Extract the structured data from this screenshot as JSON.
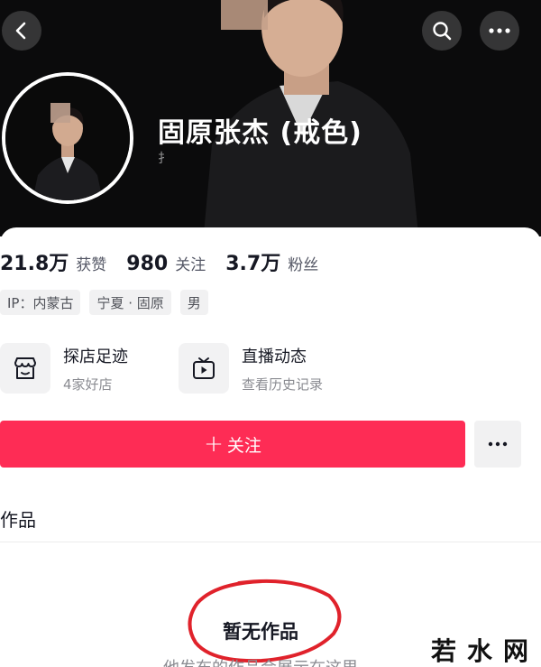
{
  "profile": {
    "nickname": "固原张杰 (戒色)",
    "sub_hint": "扌"
  },
  "stats": [
    {
      "num": "21.8万",
      "label": "获赞"
    },
    {
      "num": "980",
      "label": "关注"
    },
    {
      "num": "3.7万",
      "label": "粉丝"
    }
  ],
  "tags": [
    "IP：内蒙古",
    "宁夏 · 固原",
    "男"
  ],
  "services": {
    "shop": {
      "title": "探店足迹",
      "sub": "4家好店",
      "icon": "shop-icon"
    },
    "live": {
      "title": "直播动态",
      "sub": "查看历史记录",
      "icon": "tv-icon"
    }
  },
  "actions": {
    "follow_label": "关注",
    "follow_plus": "+"
  },
  "tabs": {
    "works": "作品"
  },
  "empty": {
    "title": "暂无作品",
    "sub": "他发布的作品会展示在这里"
  },
  "watermark": "若水网",
  "colors": {
    "accent": "#fe2c55",
    "annotation": "#e0222b",
    "hero_bg": "#0b0b0c"
  },
  "icons": {
    "back": "chevron-left-icon",
    "search": "search-icon",
    "more": "more-horizontal-icon"
  }
}
